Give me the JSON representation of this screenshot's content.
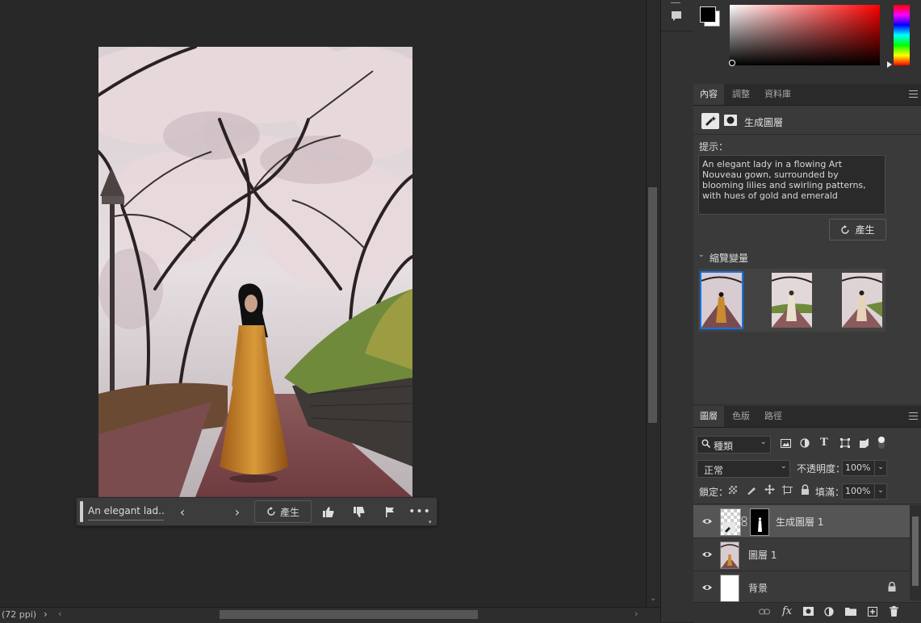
{
  "status": {
    "resolution": "(72 ppi)"
  },
  "context_bar": {
    "prompt_preview": "An elegant lad...",
    "generate_label": "產生"
  },
  "properties_panel": {
    "tabs": [
      "內容",
      "調整",
      "資料庫"
    ],
    "layer_type_label": "生成圖層",
    "prompt_label": "提示：",
    "prompt_text": "An elegant lady in a flowing Art Nouveau gown, surrounded by blooming lilies and swirling patterns, with hues of gold and emerald",
    "generate_label": "產生",
    "variations_label": "縮覽變量",
    "variations_count": 3,
    "selected_variation": 1
  },
  "layers_panel": {
    "tabs": [
      "圖層",
      "色版",
      "路徑"
    ],
    "filter_kind": "種類",
    "blend_mode": "正常",
    "opacity_label": "不透明度：",
    "opacity_value": "100%",
    "lock_label": "鎖定：",
    "fill_label": "填滿：",
    "fill_value": "100%",
    "layers": [
      {
        "name": "生成圖層",
        "suffix": "1",
        "selected": true
      },
      {
        "name": "圖層",
        "suffix": "1",
        "selected": false
      },
      {
        "name": "背景",
        "suffix": "",
        "selected": false,
        "locked": true
      }
    ]
  },
  "colors": {
    "accent": "#1473e6",
    "foreground": "#000000",
    "background": "#ffffff",
    "picker_hue": "#ff0000"
  },
  "icons": [
    "comment-icon",
    "search-icon",
    "image-filter-icon",
    "adjustment-filter-icon",
    "type-filter-icon",
    "shape-filter-icon",
    "smartobject-filter-icon",
    "link-icon",
    "fx-icon",
    "mask-icon",
    "new-fill-icon",
    "folder-icon",
    "new-layer-icon",
    "trash-icon",
    "thumbs-up-icon",
    "thumbs-down-icon",
    "flag-icon",
    "more-icon"
  ]
}
